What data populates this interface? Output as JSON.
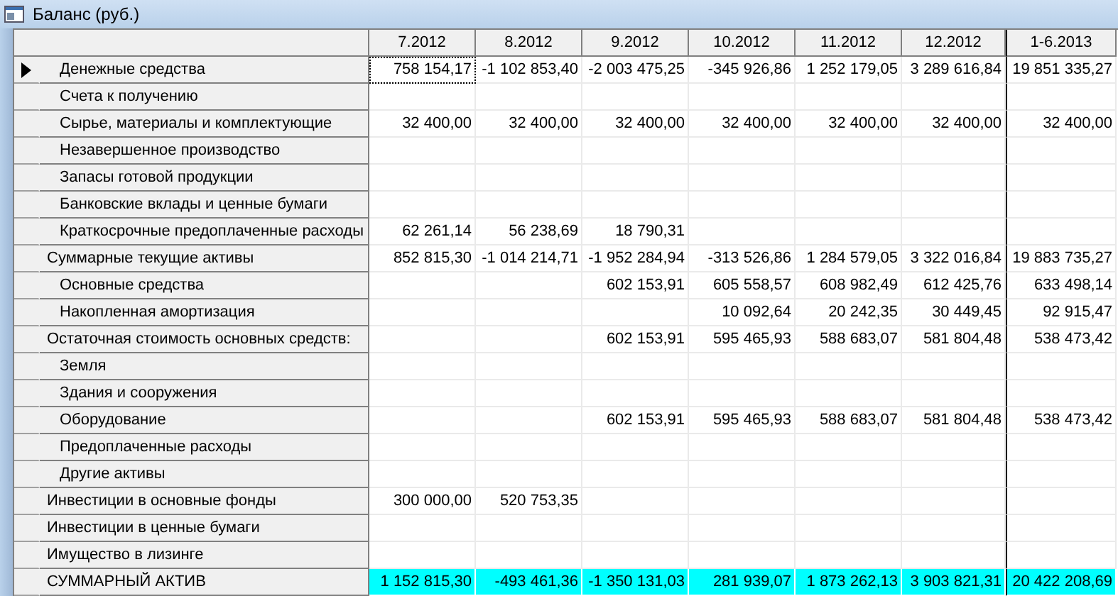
{
  "window": {
    "title": "Баланс (руб.)"
  },
  "table": {
    "columns": [
      "7.2012",
      "8.2012",
      "9.2012",
      "10.2012",
      "11.2012",
      "12.2012",
      "1-6.2013"
    ],
    "rows": [
      {
        "label": "Денежные средства",
        "kind": "item",
        "current": true,
        "highlighted": false,
        "values": {
          "column_1": "758 154,17",
          "column_2": "-1 102 853,40",
          "column_3": "-2 003 475,25",
          "column_4": "-345 926,86",
          "column_5": "1 252 179,05",
          "column_6": "3 289 616,84",
          "column_7": "19 851 335,27"
        }
      },
      {
        "label": "Счета к получению",
        "kind": "item",
        "current": false,
        "highlighted": false
      },
      {
        "label": "Сырье, материалы и комплектующие",
        "kind": "item",
        "current": false,
        "highlighted": false,
        "values": {
          "column_1": "32 400,00",
          "column_2": "32 400,00",
          "column_3": "32 400,00",
          "column_4": "32 400,00",
          "column_5": "32 400,00",
          "column_6": "32 400,00",
          "column_7": "32 400,00"
        }
      },
      {
        "label": "Незавершенное производство",
        "kind": "item",
        "current": false,
        "highlighted": false
      },
      {
        "label": "Запасы готовой продукции",
        "kind": "item",
        "current": false,
        "highlighted": false
      },
      {
        "label": "Банковские вклады и ценные бумаги",
        "kind": "item",
        "current": false,
        "highlighted": false
      },
      {
        "label": "Краткосрочные предоплаченные расходы",
        "kind": "item",
        "current": false,
        "highlighted": false,
        "values": {
          "column_1": "62 261,14",
          "column_2": "56 238,69",
          "column_3": "18 790,31"
        }
      },
      {
        "label": "Суммарные текущие активы",
        "kind": "total",
        "current": false,
        "highlighted": false,
        "values": {
          "column_1": "852 815,30",
          "column_2": "-1 014 214,71",
          "column_3": "-1 952 284,94",
          "column_4": "-313 526,86",
          "column_5": "1 284 579,05",
          "column_6": "3 322 016,84",
          "column_7": "19 883 735,27"
        }
      },
      {
        "label": "Основные средства",
        "kind": "item",
        "current": false,
        "highlighted": false,
        "values": {
          "column_3": "602 153,91",
          "column_4": "605 558,57",
          "column_5": "608 982,49",
          "column_6": "612 425,76",
          "column_7": "633 498,14"
        }
      },
      {
        "label": "Накопленная амортизация",
        "kind": "item",
        "current": false,
        "highlighted": false,
        "values": {
          "column_4": "10 092,64",
          "column_5": "20 242,35",
          "column_6": "30 449,45",
          "column_7": "92 915,47"
        }
      },
      {
        "label": "Остаточная стоимость основных средств:",
        "kind": "total",
        "current": false,
        "highlighted": false,
        "values": {
          "column_3": "602 153,91",
          "column_4": "595 465,93",
          "column_5": "588 683,07",
          "column_6": "581 804,48",
          "column_7": "538 473,42"
        }
      },
      {
        "label": "Земля",
        "kind": "item",
        "current": false,
        "highlighted": false
      },
      {
        "label": "Здания и сооружения",
        "kind": "item",
        "current": false,
        "highlighted": false
      },
      {
        "label": "Оборудование",
        "kind": "item",
        "current": false,
        "highlighted": false,
        "values": {
          "column_3": "602 153,91",
          "column_4": "595 465,93",
          "column_5": "588 683,07",
          "column_6": "581 804,48",
          "column_7": "538 473,42"
        }
      },
      {
        "label": "Предоплаченные расходы",
        "kind": "item",
        "current": false,
        "highlighted": false
      },
      {
        "label": "Другие активы",
        "kind": "item",
        "current": false,
        "highlighted": false
      },
      {
        "label": "Инвестиции в основные фонды",
        "kind": "total",
        "current": false,
        "highlighted": false,
        "values": {
          "column_1": "300 000,00",
          "column_2": "520 753,35"
        }
      },
      {
        "label": "Инвестиции в ценные бумаги",
        "kind": "total",
        "current": false,
        "highlighted": false
      },
      {
        "label": "Имущество в лизинге",
        "kind": "total",
        "current": false,
        "highlighted": false
      },
      {
        "label": "СУММАРНЫЙ АКТИВ",
        "kind": "total",
        "current": false,
        "highlighted": true,
        "values": {
          "column_1": "1 152 815,30",
          "column_2": "-493 461,36",
          "column_3": "-1 350 131,03",
          "column_4": "281 939,07",
          "column_5": "1 873 262,13",
          "column_6": "3 903 821,31",
          "column_7": "20 422 208,69"
        }
      }
    ]
  }
}
